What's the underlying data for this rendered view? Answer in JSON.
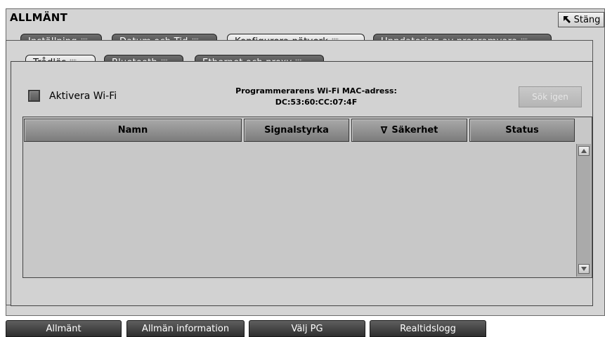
{
  "window": {
    "title": "ALLMÄNT",
    "close_label": "Stäng"
  },
  "main_tabs": [
    {
      "label": "Inställning",
      "active": false
    },
    {
      "label": "Datum och Tid",
      "active": false
    },
    {
      "label": "Konfigurera nätverk",
      "active": true
    },
    {
      "label": "Uppdatering av programvara",
      "active": false
    }
  ],
  "sub_tabs": [
    {
      "label": "Trådlös",
      "active": true
    },
    {
      "label": "Bluetooth",
      "active": false
    },
    {
      "label": "Ethernet och proxy",
      "active": false
    }
  ],
  "wifi": {
    "enable_label": "Aktivera Wi-Fi",
    "enabled": false,
    "mac_title": "Programmerarens Wi-Fi MAC-adress:",
    "mac_value": "DC:53:60:CC:07:4F",
    "search_again_label": "Sök igen",
    "search_again_enabled": false
  },
  "network_table": {
    "columns": [
      "Namn",
      "Signalstyrka",
      "Säkerhet",
      "Status"
    ],
    "sort_column": "Säkerhet",
    "sort_indicator": "∇",
    "rows": []
  },
  "bottom_nav": [
    {
      "label": "Allmänt"
    },
    {
      "label": "Allmän information"
    },
    {
      "label": "Välj PG"
    },
    {
      "label": "Realtidslogg"
    }
  ],
  "icons": {
    "close": "arrow-up-left-icon",
    "tab_grip": "grip-dots-icon",
    "sort": "sort-indicator-icon",
    "scroll_up": "scroll-up-icon",
    "scroll_down": "scroll-down-icon"
  }
}
